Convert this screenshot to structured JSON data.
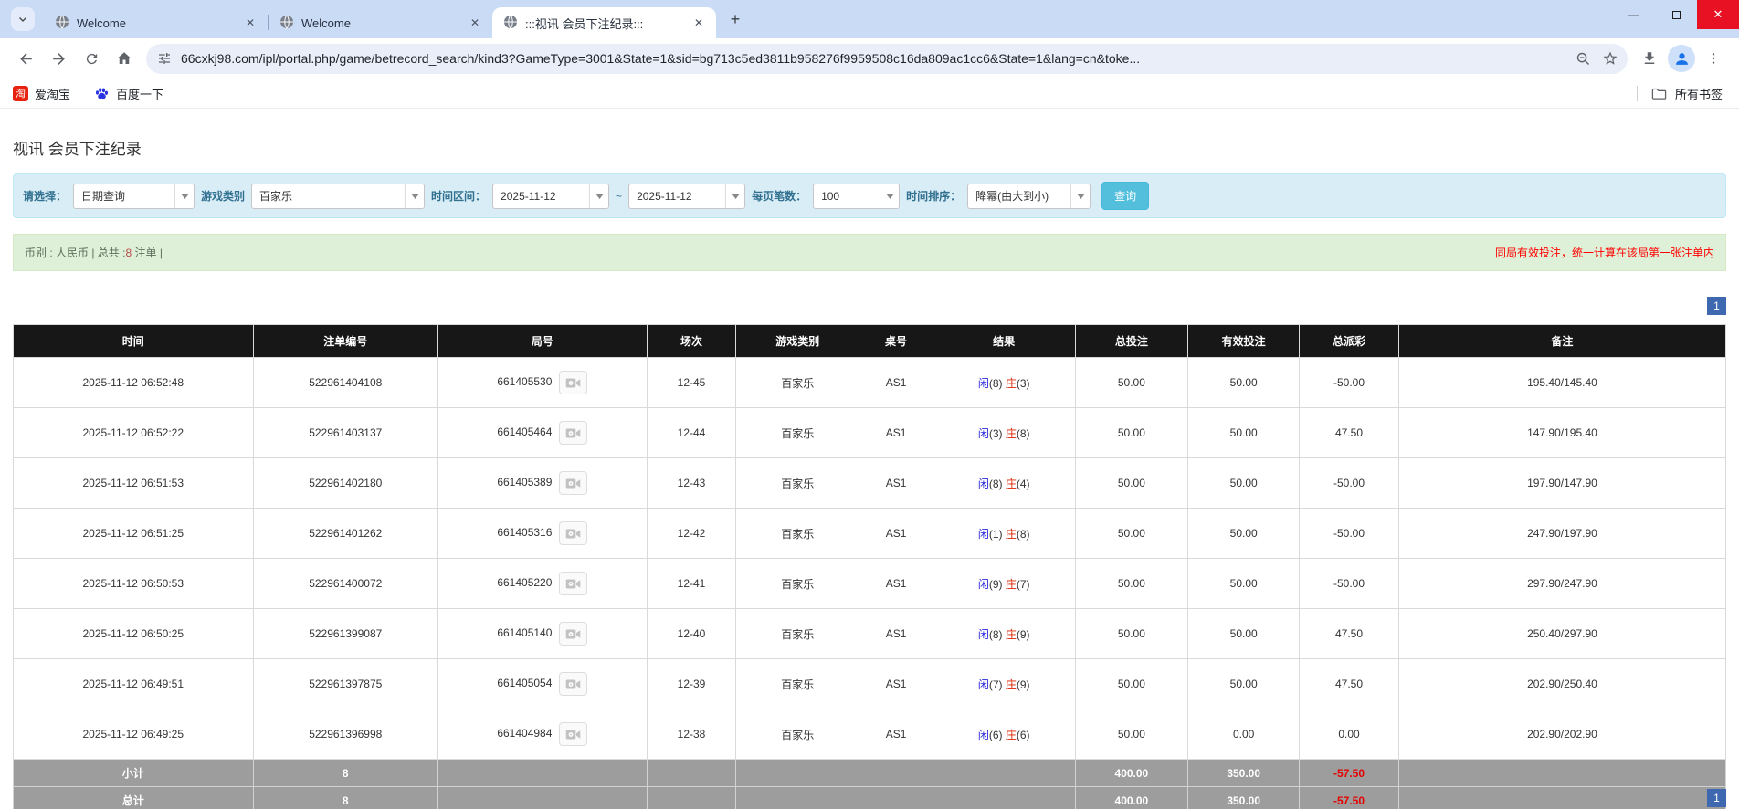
{
  "browser": {
    "tabs": [
      {
        "title": "Welcome"
      },
      {
        "title": "Welcome"
      },
      {
        "title": ":::视讯 会员下注纪录:::"
      }
    ],
    "address_bar": {
      "url": "66cxkj98.com/ipl/portal.php/game/betrecord_search/kind3?GameType=3001&State=1&sid=bg713c5ed3811b958276f9959508c16da809ac1cc6&State=1&lang=cn&toke..."
    },
    "bookmarks_bar": {
      "items": [
        {
          "label": "爱淘宝"
        },
        {
          "label": "百度一下"
        }
      ],
      "all_bookmarks_label": "所有书签"
    }
  },
  "page": {
    "title": "视讯 会员下注纪录",
    "filter_bar": {
      "query_type_label": "请选择：",
      "query_type_value": "日期查询",
      "game_category_label": "游戏类别",
      "game_category_value": "百家乐",
      "date_range_label": "时间区间：",
      "date_from": "2025-11-12",
      "date_separator": "~",
      "date_to": "2025-11-12",
      "page_size_label": "每页笔数：",
      "page_size_value": "100",
      "time_sort_label": "时间排序：",
      "time_sort_value": "降幂(由大到小)",
      "search_button_label": "查询"
    },
    "summary_bar": {
      "left_prefix": "币别 : 人民币 | 总共 :",
      "order_count": "8",
      "left_suffix": " 注单 |",
      "right_note": "同局有效投注，统一计算在该局第一张注单内"
    },
    "pagination": {
      "page_label": "1"
    },
    "table": {
      "headers": [
        "时间",
        "注单编号",
        "局号",
        "场次",
        "游戏类别",
        "桌号",
        "结果",
        "总投注",
        "有效投注",
        "总派彩",
        "备注"
      ],
      "rows": [
        {
          "time": "2025-11-12 06:52:48",
          "order_id": "522961404108",
          "round_id": "661405530",
          "session": "12-45",
          "game_category": "百家乐",
          "table_no": "AS1",
          "result_player": "闲(8)",
          "result_banker": "庄(3)",
          "total_bet": "50.00",
          "valid_bet": "50.00",
          "total_payout": "-50.00",
          "remark": "195.40/145.40"
        },
        {
          "time": "2025-11-12 06:52:22",
          "order_id": "522961403137",
          "round_id": "661405464",
          "session": "12-44",
          "game_category": "百家乐",
          "table_no": "AS1",
          "result_player": "闲(3)",
          "result_banker": "庄(8)",
          "total_bet": "50.00",
          "valid_bet": "50.00",
          "total_payout": "47.50",
          "remark": "147.90/195.40"
        },
        {
          "time": "2025-11-12 06:51:53",
          "order_id": "522961402180",
          "round_id": "661405389",
          "session": "12-43",
          "game_category": "百家乐",
          "table_no": "AS1",
          "result_player": "闲(8)",
          "result_banker": "庄(4)",
          "total_bet": "50.00",
          "valid_bet": "50.00",
          "total_payout": "-50.00",
          "remark": "197.90/147.90"
        },
        {
          "time": "2025-11-12 06:51:25",
          "order_id": "522961401262",
          "round_id": "661405316",
          "session": "12-42",
          "game_category": "百家乐",
          "table_no": "AS1",
          "result_player": "闲(1)",
          "result_banker": "庄(8)",
          "total_bet": "50.00",
          "valid_bet": "50.00",
          "total_payout": "-50.00",
          "remark": "247.90/197.90"
        },
        {
          "time": "2025-11-12 06:50:53",
          "order_id": "522961400072",
          "round_id": "661405220",
          "session": "12-41",
          "game_category": "百家乐",
          "table_no": "AS1",
          "result_player": "闲(9)",
          "result_banker": "庄(7)",
          "total_bet": "50.00",
          "valid_bet": "50.00",
          "total_payout": "-50.00",
          "remark": "297.90/247.90"
        },
        {
          "time": "2025-11-12 06:50:25",
          "order_id": "522961399087",
          "round_id": "661405140",
          "session": "12-40",
          "game_category": "百家乐",
          "table_no": "AS1",
          "result_player": "闲(8)",
          "result_banker": "庄(9)",
          "total_bet": "50.00",
          "valid_bet": "50.00",
          "total_payout": "47.50",
          "remark": "250.40/297.90"
        },
        {
          "time": "2025-11-12 06:49:51",
          "order_id": "522961397875",
          "round_id": "661405054",
          "session": "12-39",
          "game_category": "百家乐",
          "table_no": "AS1",
          "result_player": "闲(7)",
          "result_banker": "庄(9)",
          "total_bet": "50.00",
          "valid_bet": "50.00",
          "total_payout": "47.50",
          "remark": "202.90/250.40"
        },
        {
          "time": "2025-11-12 06:49:25",
          "order_id": "522961396998",
          "round_id": "661404984",
          "session": "12-38",
          "game_category": "百家乐",
          "table_no": "AS1",
          "result_player": "闲(6)",
          "result_banker": "庄(6)",
          "total_bet": "50.00",
          "valid_bet": "0.00",
          "total_payout": "0.00",
          "remark": "202.90/202.90"
        }
      ],
      "subtotal_row": {
        "label": "小计",
        "order_count": "8",
        "total_bet": "400.00",
        "valid_bet": "350.00",
        "total_payout": "-57.50"
      },
      "total_row": {
        "label": "总计",
        "order_count": "8",
        "total_bet": "400.00",
        "valid_bet": "350.00",
        "total_payout": "-57.50"
      }
    },
    "colors": {
      "pagination_blue": "#3e68b0",
      "player_blue": "#2929dd",
      "banker_red": "#dd2200",
      "bet_link_blue": "#3273dc",
      "negative_red": "#f00000",
      "note_red": "#ff0000",
      "filter_bg": "#d9edf7",
      "info_bg": "#dff0d8",
      "header_bg": "#171717",
      "sum_row_bg": "#9d9d9d"
    }
  }
}
